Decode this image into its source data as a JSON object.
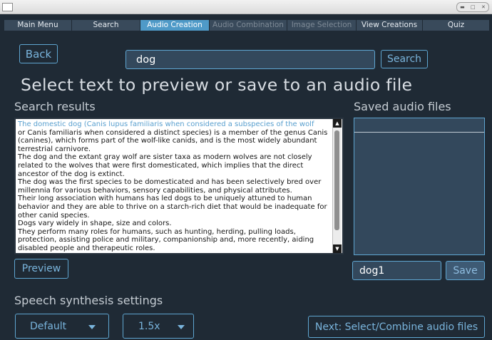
{
  "tabs": [
    {
      "label": "Main Menu",
      "state": "normal"
    },
    {
      "label": "Search",
      "state": "normal"
    },
    {
      "label": "Audio Creation",
      "state": "active"
    },
    {
      "label": "Audio Combination",
      "state": "disabled"
    },
    {
      "label": "Image Selection",
      "state": "disabled"
    },
    {
      "label": "View Creations",
      "state": "normal"
    },
    {
      "label": "Quiz",
      "state": "normal"
    }
  ],
  "back_label": "Back",
  "search": {
    "value": "dog",
    "button_label": "Search"
  },
  "heading": "Select text to preview or save to an audio file",
  "results": {
    "label": "Search results",
    "selected_text": "The domestic dog (Canis lupus familiaris when considered a subspecies of the wolf",
    "paragraphs": [
      "or Canis familiaris when considered a distinct species) is a member of the genus Canis (canines), which forms part of the wolf-like canids, and is the most widely abundant terrestrial carnivore.",
      "The dog and the extant gray wolf are sister taxa as modern wolves are not closely related to the wolves that were first domesticated, which implies that the direct ancestor of the dog is extinct.",
      "The dog was the first species to be domesticated and has been selectively bred over millennia for various behaviors, sensory capabilities, and physical attributes.",
      "Their long association with humans has led dogs to be uniquely attuned to human behavior and they are able to thrive on a starch-rich diet that would be inadequate for other canid species.",
      "Dogs vary widely in shape, size and colors.",
      "They perform many roles for humans, such as hunting, herding, pulling loads, protection, assisting police and military, companionship and, more recently, aiding disabled people and therapeutic roles."
    ]
  },
  "preview_label": "Preview",
  "saved": {
    "label": "Saved audio files",
    "filename": "dog1",
    "save_label": "Save"
  },
  "speech": {
    "label": "Speech synthesis settings",
    "voice": "Default",
    "speed": "1.5x"
  },
  "next_label": "Next: Select/Combine audio files",
  "colors": {
    "accent": "#5fa6d1",
    "background": "#1f2a35",
    "active_tab": "#4f9ac8"
  }
}
